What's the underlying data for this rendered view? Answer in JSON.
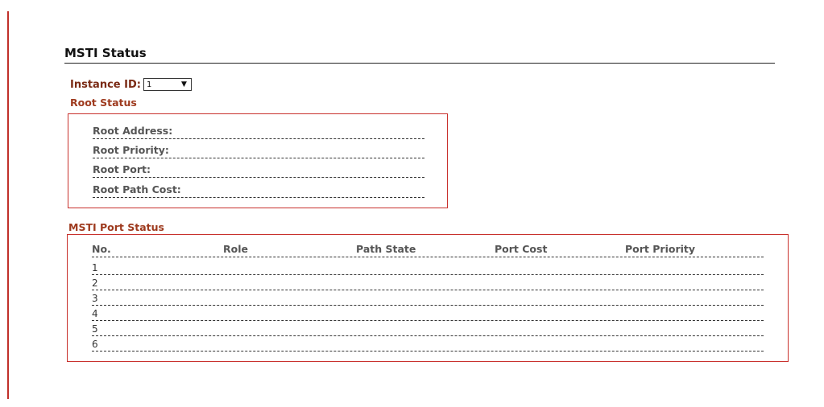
{
  "page": {
    "title": "MSTI Status"
  },
  "instance": {
    "label": "Instance ID:",
    "selected": "1",
    "arrow": "▼"
  },
  "root_status": {
    "title": "Root Status",
    "rows": [
      {
        "label": "Root Address:",
        "value": ""
      },
      {
        "label": "Root Priority:",
        "value": ""
      },
      {
        "label": "Root Port:",
        "value": ""
      },
      {
        "label": "Root Path Cost:",
        "value": ""
      }
    ]
  },
  "port_status": {
    "title": "MSTI Port Status",
    "columns": [
      "No.",
      "Role",
      "Path State",
      "Port Cost",
      "Port Priority"
    ],
    "rows": [
      [
        "1",
        "",
        "",
        "",
        ""
      ],
      [
        "2",
        "",
        "",
        "",
        ""
      ],
      [
        "3",
        "",
        "",
        "",
        ""
      ],
      [
        "4",
        "",
        "",
        "",
        ""
      ],
      [
        "5",
        "",
        "",
        "",
        ""
      ],
      [
        "6",
        "",
        "",
        "",
        ""
      ]
    ]
  },
  "colors": {
    "accent_border": "#c8302c",
    "section_title": "#9e3a1e",
    "label_text": "#555555"
  }
}
